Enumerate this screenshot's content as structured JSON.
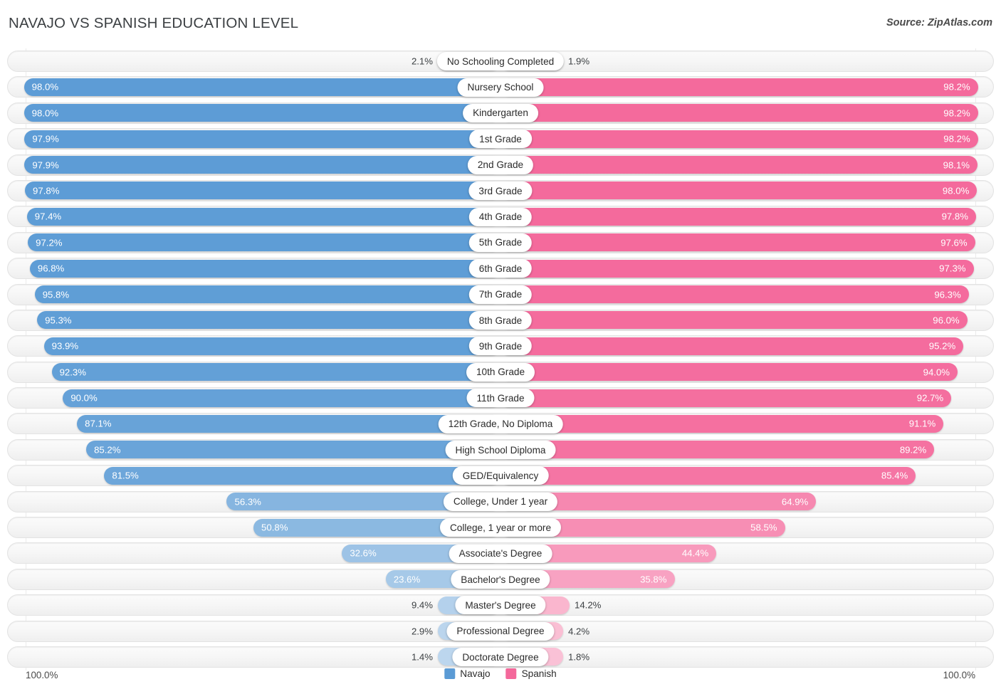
{
  "header": {
    "title": "NAVAJO VS SPANISH EDUCATION LEVEL",
    "source": "Source: ZipAtlas.com"
  },
  "legend": {
    "navajo_label": "Navajo",
    "spanish_label": "Spanish",
    "navajo_color": "#5b9bd5",
    "spanish_color": "#f4689b"
  },
  "axis": {
    "left_max": "100.0%",
    "right_max": "100.0%"
  },
  "chart_data": {
    "type": "bar",
    "orientation": "horizontal-diverging",
    "title": "NAVAJO VS SPANISH EDUCATION LEVEL",
    "xlabel": "",
    "ylabel": "",
    "xlim": [
      0,
      100
    ],
    "grid": false,
    "legend_position": "bottom-center",
    "categories": [
      "No Schooling Completed",
      "Nursery School",
      "Kindergarten",
      "1st Grade",
      "2nd Grade",
      "3rd Grade",
      "4th Grade",
      "5th Grade",
      "6th Grade",
      "7th Grade",
      "8th Grade",
      "9th Grade",
      "10th Grade",
      "11th Grade",
      "12th Grade, No Diploma",
      "High School Diploma",
      "GED/Equivalency",
      "College, Under 1 year",
      "College, 1 year or more",
      "Associate's Degree",
      "Bachelor's Degree",
      "Master's Degree",
      "Professional Degree",
      "Doctorate Degree"
    ],
    "series": [
      {
        "name": "Navajo",
        "color": "#5b9bd5",
        "values": [
          2.1,
          98.0,
          98.0,
          97.9,
          97.9,
          97.8,
          97.4,
          97.2,
          96.8,
          95.8,
          95.3,
          93.9,
          92.3,
          90.0,
          87.1,
          85.2,
          81.5,
          56.3,
          50.8,
          32.6,
          23.6,
          9.4,
          2.9,
          1.4
        ],
        "labels": [
          "2.1%",
          "98.0%",
          "98.0%",
          "97.9%",
          "97.9%",
          "97.8%",
          "97.4%",
          "97.2%",
          "96.8%",
          "95.8%",
          "95.3%",
          "93.9%",
          "92.3%",
          "90.0%",
          "87.1%",
          "85.2%",
          "81.5%",
          "56.3%",
          "50.8%",
          "32.6%",
          "23.6%",
          "9.4%",
          "2.9%",
          "1.4%"
        ]
      },
      {
        "name": "Spanish",
        "color": "#f4689b",
        "values": [
          1.9,
          98.2,
          98.2,
          98.2,
          98.1,
          98.0,
          97.8,
          97.6,
          97.3,
          96.3,
          96.0,
          95.2,
          94.0,
          92.7,
          91.1,
          89.2,
          85.4,
          64.9,
          58.5,
          44.4,
          35.8,
          14.2,
          4.2,
          1.8
        ],
        "labels": [
          "1.9%",
          "98.2%",
          "98.2%",
          "98.2%",
          "98.1%",
          "98.0%",
          "97.8%",
          "97.6%",
          "97.3%",
          "96.3%",
          "96.0%",
          "95.2%",
          "94.0%",
          "92.7%",
          "91.1%",
          "89.2%",
          "85.4%",
          "64.9%",
          "58.5%",
          "44.4%",
          "35.8%",
          "14.2%",
          "4.2%",
          "1.8%"
        ]
      }
    ]
  }
}
